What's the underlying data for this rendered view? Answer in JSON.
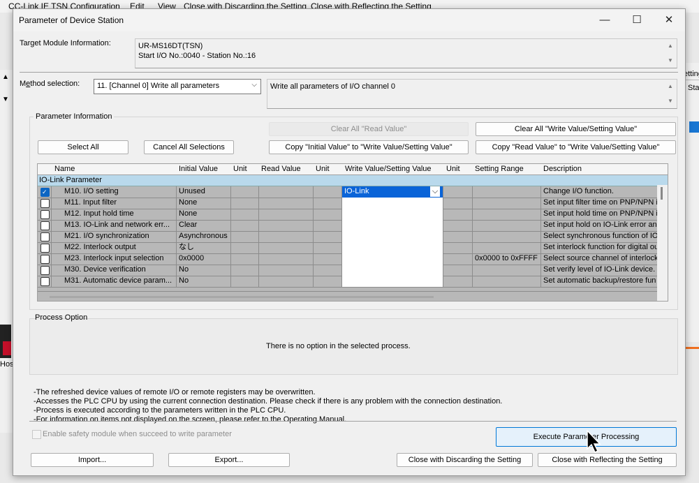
{
  "background": {
    "menu": [
      "CC-Link IE TSN Configuration",
      "Edit",
      "View",
      "Close with Discarding the Setting",
      "Close with Reflecting the Setting"
    ],
    "right_fragments": [
      "etting",
      "Sta"
    ],
    "left_fragments": [
      "Hos"
    ]
  },
  "dialog": {
    "title": "Parameter of Device Station",
    "minimize": "—",
    "maximize": "☐",
    "close": "✕"
  },
  "target": {
    "label": "Target Module Information:",
    "line1": "UR-MS16DT(TSN)",
    "line2": "Start I/O No.:0040 - Station No.:16"
  },
  "method": {
    "label_pre": "M",
    "label_u": "e",
    "label_post": "thod selection:",
    "selected": "11. [Channel 0] Write all parameters",
    "description": "Write all parameters of I/O channel 0"
  },
  "param_info": {
    "title": "Parameter Information",
    "clear_read": "Clear All \"Read Value\"",
    "clear_write": "Clear All \"Write Value/Setting Value\"",
    "select_all": "Select All",
    "cancel_all": "Cancel All Selections",
    "copy_initial": "Copy \"Initial Value\" to \"Write Value/Setting Value\"",
    "copy_read": "Copy \"Read Value\" to \"Write Value/Setting Value\""
  },
  "grid": {
    "headers": [
      "Name",
      "Initial Value",
      "Unit",
      "Read Value",
      "Unit",
      "Write Value/Setting Value",
      "Unit",
      "Setting Range",
      "Description"
    ],
    "section": "IO-Link Parameter",
    "rows": [
      {
        "checked": true,
        "name": "M10. I/O setting",
        "initial": "Unused",
        "write": "IO-Link",
        "range": "",
        "desc": "Change I/O function."
      },
      {
        "checked": false,
        "name": "M11. Input filter",
        "initial": "None",
        "write": "",
        "range": "",
        "desc": "Set input filter time on PNP/NPN in"
      },
      {
        "checked": false,
        "name": "M12. Input hold time",
        "initial": "None",
        "write": "",
        "range": "",
        "desc": "Set input hold time on PNP/NPN in"
      },
      {
        "checked": false,
        "name": "M13. IO-Link and network err...",
        "initial": "Clear",
        "write": "",
        "range": "",
        "desc": "Set input hold on IO-Link error an"
      },
      {
        "checked": false,
        "name": "M21. I/O synchronization",
        "initial": "Asynchronous",
        "write": "",
        "range": "",
        "desc": "Select synchronous function of IO"
      },
      {
        "checked": false,
        "name": "M22. Interlock output",
        "initial": "なし",
        "write": "",
        "range": "",
        "desc": "Set interlock function for digital ou"
      },
      {
        "checked": false,
        "name": "M23. Interlock input selection",
        "initial": "0x0000",
        "write": "",
        "range": "0x0000 to 0xFFFF",
        "desc": "Select source channel of interlock"
      },
      {
        "checked": false,
        "name": "M30. Device verification",
        "initial": "No",
        "write": "",
        "range": "",
        "desc": "Set verify level of IO-Link device."
      },
      {
        "checked": false,
        "name": "M31. Automatic device param...",
        "initial": "No",
        "write": "",
        "range": "",
        "desc": "Set automatic backup/restore fun"
      }
    ]
  },
  "process": {
    "title": "Process Option",
    "message": "There is no option in the selected process."
  },
  "notes": [
    "-The refreshed device values of remote I/O or remote registers may be overwritten.",
    "-Accesses the PLC CPU by using the current connection destination. Please check if there is any problem with the connection destination.",
    "-Process is executed according to the parameters written in the PLC CPU.",
    "-For information on items not displayed on the screen, please refer to the Operating Manual."
  ],
  "footer": {
    "safety": "Enable safety module when succeed to write parameter",
    "execute": "Execute Parameter Processing",
    "import": "Import...",
    "export": "Export...",
    "close_discard": "Close with Discarding the Setting",
    "close_reflect": "Close with Reflecting the Setting"
  }
}
